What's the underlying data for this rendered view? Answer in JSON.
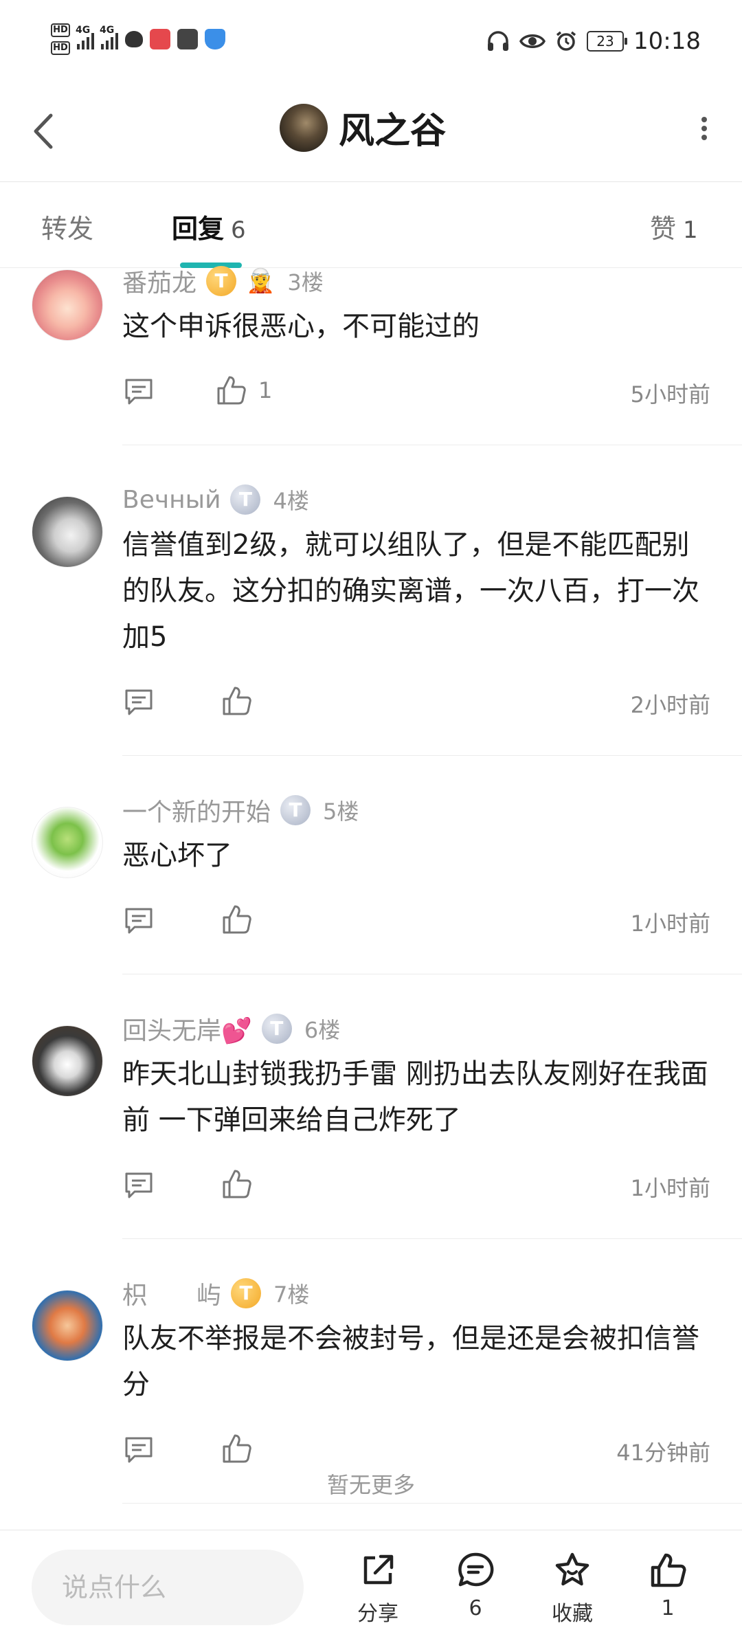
{
  "status_bar": {
    "network_1": "4G",
    "network_2": "4G",
    "battery": "23",
    "time": "10:18"
  },
  "header": {
    "title": "风之谷"
  },
  "tabs": [
    {
      "label": "转发",
      "count": ""
    },
    {
      "label": "回复",
      "count": "6"
    },
    {
      "label": "赞",
      "count": "1"
    }
  ],
  "comments": [
    {
      "user": "番茄龙",
      "badge": "T",
      "badge_style": "gold",
      "emoji": "🧝",
      "floor": "3楼",
      "text": "这个申诉很恶心，不可能过的",
      "likes": "1",
      "time": "5小时前"
    },
    {
      "user": "Вечный",
      "badge": "T",
      "badge_style": "silver",
      "emoji": "",
      "floor": "4楼",
      "text": "信誉值到2级，就可以组队了，但是不能匹配别的队友。这分扣的确实离谱，一次八百，打一次加5",
      "likes": "",
      "time": "2小时前"
    },
    {
      "user": "一个新的开始",
      "badge": "T",
      "badge_style": "silver",
      "emoji": "",
      "floor": "5楼",
      "text": "恶心坏了",
      "likes": "",
      "time": "1小时前"
    },
    {
      "user": "回头无岸💕",
      "badge": "T",
      "badge_style": "silver",
      "emoji": "",
      "floor": "6楼",
      "text": "昨天北山封锁我扔手雷 刚扔出去队友刚好在我面前 一下弹回来给自己炸死了",
      "likes": "",
      "time": "1小时前"
    },
    {
      "user": "枳　　屿",
      "badge": "T",
      "badge_style": "gold",
      "emoji": "",
      "floor": "7楼",
      "text": "队友不举报是不会被封号，但是还是会被扣信誉分",
      "likes": "",
      "time": "41分钟前"
    }
  ],
  "footer_note": "暂无更多",
  "bottom_bar": {
    "input_placeholder": "说点什么",
    "share_label": "分享",
    "comment_count": "6",
    "favorite_label": "收藏",
    "like_count": "1"
  },
  "colors": {
    "accent": "#1fb5b0",
    "gold_badge": "#f3a928",
    "silver_badge": "#a9b2c5"
  }
}
